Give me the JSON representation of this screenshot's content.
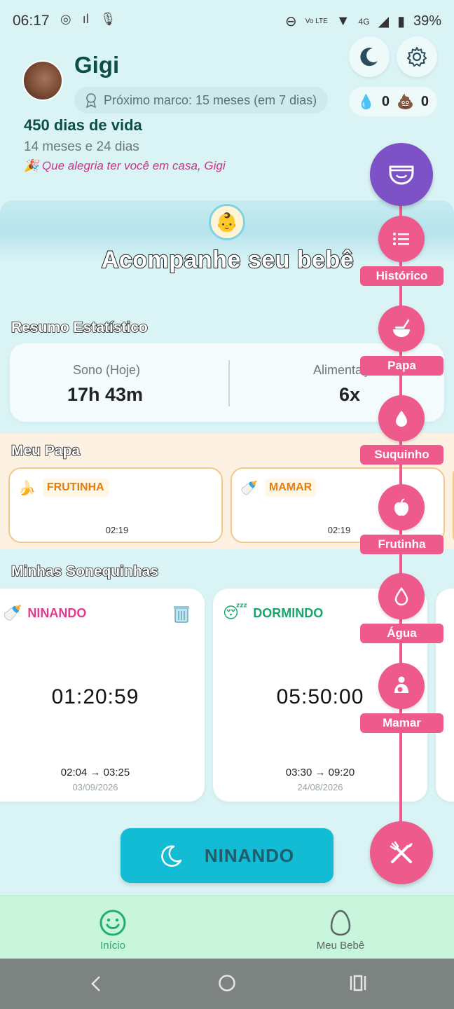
{
  "status_bar": {
    "time": "06:17",
    "battery": "39%",
    "network": "4G",
    "volte": "Vo LTE"
  },
  "header": {
    "baby_name": "Gigi",
    "milestone": "Próximo marco: 15 meses (em 7 dias)",
    "days_of_life": "450 dias de vida",
    "age": "14 meses e 24 dias",
    "welcome": "Que alegria ter você em casa, Gigi",
    "welcome_emoji": "🎉",
    "water_count": "0",
    "poop_count": "0"
  },
  "hero": {
    "title": "Acompanhe seu bebê",
    "emoji": "👶"
  },
  "stats": {
    "section_title": "Resumo Estatístico",
    "sleep_label": "Sono (Hoje)",
    "sleep_value": "17h 43m",
    "food_label": "Alimentação",
    "food_value": "6x"
  },
  "papa": {
    "section_title": "Meu Papa",
    "cards": [
      {
        "emoji": "🍌",
        "label": "FRUTINHA",
        "time": "02:19"
      },
      {
        "emoji": "🍼",
        "label": "MAMAR",
        "time": "02:19"
      }
    ]
  },
  "naps": {
    "section_title": "Minhas Sonequinhas",
    "cards": [
      {
        "emoji": "🍼",
        "status": "NINANDO",
        "status_color": "#e33a8f",
        "timer": "01:20:59",
        "range": "02:04 → 03:25",
        "date": "03/09/2026"
      },
      {
        "emoji": "😴",
        "status": "DORMINDO",
        "status_color": "#1aa66b",
        "timer": "05:50:00",
        "range": "03:30 → 09:20",
        "date": "24/08/2026"
      }
    ]
  },
  "main_button": {
    "label": "NINANDO"
  },
  "fab_menu": {
    "items": [
      {
        "label": "Histórico",
        "icon": "list-icon"
      },
      {
        "label": "Papa",
        "icon": "bowl-icon"
      },
      {
        "label": "Suquinho",
        "icon": "drop-icon"
      },
      {
        "label": "Frutinha",
        "icon": "apple-icon"
      },
      {
        "label": "Água",
        "icon": "water-drop-icon"
      },
      {
        "label": "Mamar",
        "icon": "nursing-icon"
      }
    ],
    "accent": "#ee5a8c",
    "diaper_color": "#7d52c6"
  },
  "bottom_nav": {
    "items": [
      {
        "label": "Início",
        "icon": "smile-icon",
        "active": true
      },
      {
        "label": "Meu Bebê",
        "icon": "egg-icon",
        "active": false
      }
    ],
    "active_color": "#1fae73"
  }
}
